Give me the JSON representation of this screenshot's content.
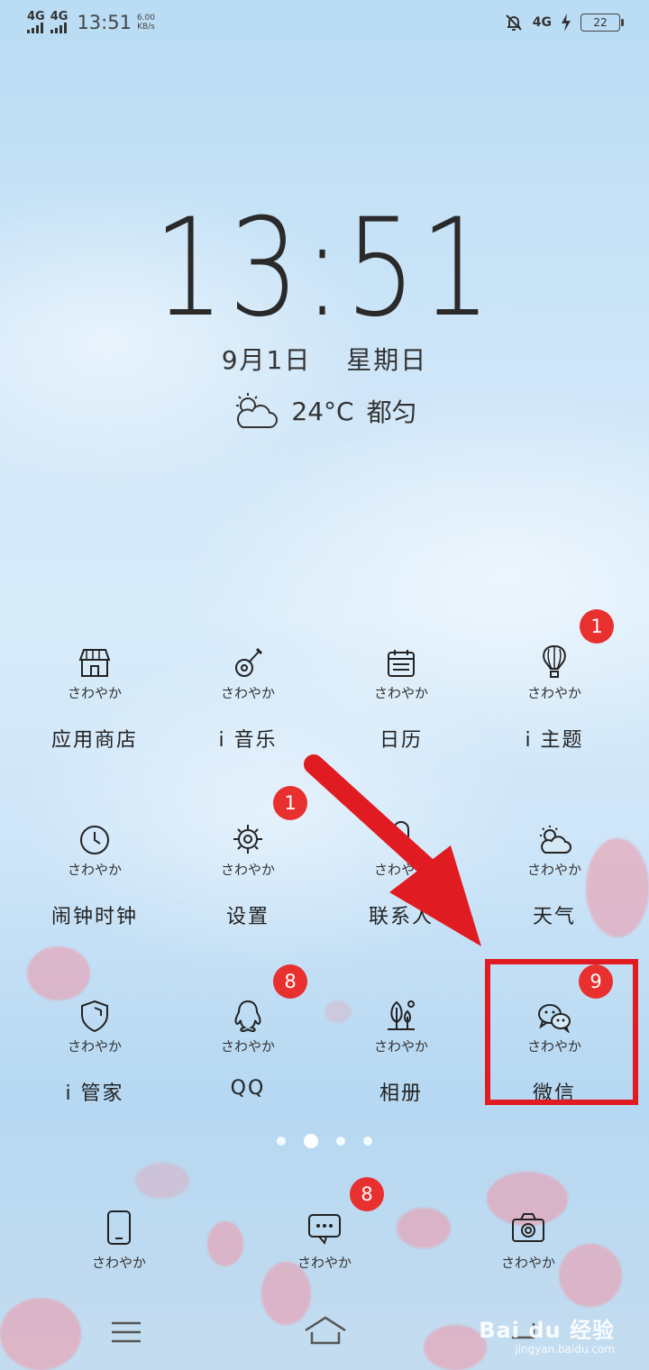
{
  "status_bar": {
    "network1": "4G",
    "network2": "4G",
    "time": "13:51",
    "speed_value": "6.00",
    "speed_unit": "KB/s",
    "network3": "4G",
    "battery": "22"
  },
  "lockscreen": {
    "clock": "13:51",
    "date": "9月1日",
    "weekday": "星期日",
    "weather_icon": "partly-cloudy-icon",
    "temperature": "24°C",
    "city": "都匀"
  },
  "apps": [
    {
      "sub": "さわやか",
      "label": "应用商店",
      "icon": "store-icon",
      "badge": ""
    },
    {
      "sub": "さわやか",
      "label": "i 音乐",
      "icon": "guitar-icon",
      "badge": ""
    },
    {
      "sub": "さわやか",
      "label": "日历",
      "icon": "calendar-icon",
      "badge": ""
    },
    {
      "sub": "さわやか",
      "label": "i 主题",
      "icon": "balloon-icon",
      "badge": "1"
    },
    {
      "sub": "さわやか",
      "label": "闹钟时钟",
      "icon": "clock-icon",
      "badge": ""
    },
    {
      "sub": "さわやか",
      "label": "设置",
      "icon": "gear-icon",
      "badge": "1"
    },
    {
      "sub": "さわやか",
      "label": "联系人",
      "icon": "contact-icon",
      "badge": ""
    },
    {
      "sub": "さわやか",
      "label": "天气",
      "icon": "weather-icon",
      "badge": ""
    },
    {
      "sub": "さわやか",
      "label": "i 管家",
      "icon": "shield-icon",
      "badge": ""
    },
    {
      "sub": "さわやか",
      "label": "QQ",
      "icon": "qq-penguin-icon",
      "badge": "8"
    },
    {
      "sub": "さわやか",
      "label": "相册",
      "icon": "tree-icon",
      "badge": ""
    },
    {
      "sub": "さわやか",
      "label": "微信",
      "icon": "wechat-icon",
      "badge": "9"
    }
  ],
  "dock": [
    {
      "sub": "さわやか",
      "icon": "phone-icon",
      "badge": ""
    },
    {
      "sub": "さわやか",
      "icon": "message-icon",
      "badge": "8"
    },
    {
      "sub": "さわやか",
      "icon": "camera-icon",
      "badge": ""
    }
  ],
  "watermark": {
    "brand": "Bai du 经验",
    "url": "jingyan.baidu.com"
  },
  "colors": {
    "badge": "#e8302f",
    "highlight": "#e11b22"
  }
}
